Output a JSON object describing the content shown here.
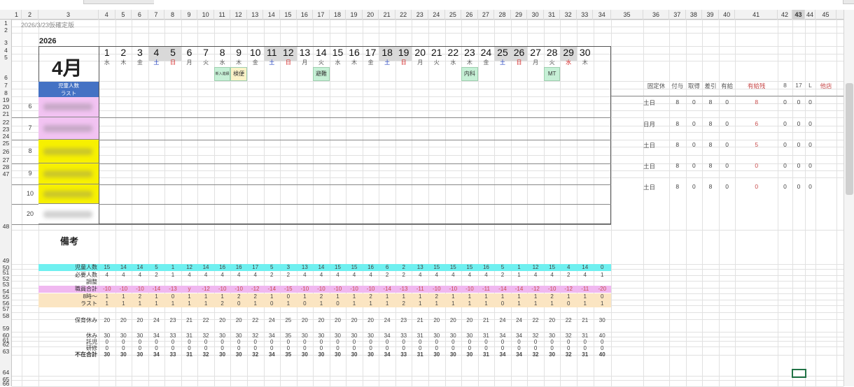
{
  "sheet": {
    "version_note": "2026/3/23仮確定版",
    "year": "2026",
    "month": "4月",
    "label_children": "児童人数",
    "label_last": "ラスト",
    "remarks_label": "備考",
    "selected_column": "43"
  },
  "column_headers": [
    "1",
    "2",
    "3",
    "4",
    "5",
    "6",
    "7",
    "8",
    "9",
    "10",
    "11",
    "12",
    "13",
    "14",
    "15",
    "16",
    "17",
    "18",
    "19",
    "20",
    "21",
    "22",
    "23",
    "24",
    "25",
    "26",
    "27",
    "28",
    "29",
    "30",
    "31",
    "32",
    "33",
    "34",
    "35",
    "36",
    "37",
    "38",
    "39",
    "40",
    "41",
    "42",
    "43",
    "44",
    "45"
  ],
  "row_headers": [
    "1",
    "2",
    "3",
    "4",
    "5",
    "6",
    "7",
    "8",
    "19",
    "20",
    "21",
    "22",
    "23",
    "24",
    "25",
    "26",
    "27",
    "28",
    "47",
    "48",
    "49",
    "50",
    "51",
    "52",
    "53",
    "54",
    "55",
    "56",
    "57",
    "58",
    "59",
    "60",
    "61",
    "62",
    "63",
    "64",
    "65",
    "66"
  ],
  "days": [
    {
      "d": "1",
      "w": "水",
      "sh": false,
      "c": "#555"
    },
    {
      "d": "2",
      "w": "木",
      "sh": false,
      "c": "#555"
    },
    {
      "d": "3",
      "w": "金",
      "sh": false,
      "c": "#555"
    },
    {
      "d": "4",
      "w": "土",
      "sh": true,
      "c": "#1f3fbf"
    },
    {
      "d": "5",
      "w": "日",
      "sh": true,
      "c": "#d42020"
    },
    {
      "d": "6",
      "w": "月",
      "sh": false,
      "c": "#555"
    },
    {
      "d": "7",
      "w": "火",
      "sh": false,
      "c": "#555"
    },
    {
      "d": "8",
      "w": "水",
      "sh": false,
      "c": "#555"
    },
    {
      "d": "9",
      "w": "木",
      "sh": false,
      "c": "#555"
    },
    {
      "d": "10",
      "w": "金",
      "sh": false,
      "c": "#555"
    },
    {
      "d": "11",
      "w": "土",
      "sh": true,
      "c": "#1f3fbf"
    },
    {
      "d": "12",
      "w": "日",
      "sh": true,
      "c": "#d42020"
    },
    {
      "d": "13",
      "w": "月",
      "sh": false,
      "c": "#555"
    },
    {
      "d": "14",
      "w": "火",
      "sh": false,
      "c": "#555"
    },
    {
      "d": "15",
      "w": "水",
      "sh": false,
      "c": "#555"
    },
    {
      "d": "16",
      "w": "木",
      "sh": false,
      "c": "#555"
    },
    {
      "d": "17",
      "w": "金",
      "sh": false,
      "c": "#555"
    },
    {
      "d": "18",
      "w": "土",
      "sh": true,
      "c": "#1f3fbf"
    },
    {
      "d": "19",
      "w": "日",
      "sh": true,
      "c": "#d42020"
    },
    {
      "d": "20",
      "w": "月",
      "sh": false,
      "c": "#555"
    },
    {
      "d": "21",
      "w": "火",
      "sh": false,
      "c": "#555"
    },
    {
      "d": "22",
      "w": "水",
      "sh": false,
      "c": "#555"
    },
    {
      "d": "23",
      "w": "木",
      "sh": false,
      "c": "#555"
    },
    {
      "d": "24",
      "w": "金",
      "sh": false,
      "c": "#555"
    },
    {
      "d": "25",
      "w": "土",
      "sh": true,
      "c": "#1f3fbf"
    },
    {
      "d": "26",
      "w": "日",
      "sh": true,
      "c": "#d42020"
    },
    {
      "d": "27",
      "w": "月",
      "sh": false,
      "c": "#555"
    },
    {
      "d": "28",
      "w": "火",
      "sh": false,
      "c": "#555"
    },
    {
      "d": "29",
      "w": "水",
      "sh": true,
      "c": "#d42020"
    },
    {
      "d": "30",
      "w": "木",
      "sh": false,
      "c": "#555"
    }
  ],
  "events": [
    {
      "day": 8,
      "text": "新入進級"
    },
    {
      "day": 9,
      "text": "検便"
    },
    {
      "day": 14,
      "text": "避難"
    },
    {
      "day": 23,
      "text": "内科"
    },
    {
      "day": 28,
      "text": "MT"
    }
  ],
  "staff_rows": [
    {
      "num": "6",
      "color": "#f2c3f2",
      "rn": [
        "19",
        "20"
      ]
    },
    {
      "num": "7",
      "color": "#f2c3f2",
      "rn": [
        "21",
        "22"
      ]
    },
    {
      "num": "8",
      "color": "#f7f000",
      "rn": [
        "23",
        "24"
      ]
    },
    {
      "num": "9",
      "color": "#f7f000",
      "rn": [
        "25",
        "26"
      ]
    },
    {
      "num": "10",
      "color": "#f7f000",
      "rn": [
        "27",
        "28"
      ]
    },
    {
      "num": "20",
      "color": "#ffffff",
      "rn": [
        "47",
        "48"
      ]
    }
  ],
  "summary_headers": [
    "固定休",
    "付与",
    "取得",
    "差引",
    "有給",
    "有給残",
    "8",
    "17",
    "L",
    "他店"
  ],
  "summary_rows": [
    [
      "土日",
      "8",
      "0",
      "8",
      "0",
      "8",
      "0",
      "0",
      "0"
    ],
    [
      "日月",
      "8",
      "0",
      "8",
      "0",
      "6",
      "0",
      "0",
      "0"
    ],
    [
      "土日",
      "8",
      "0",
      "8",
      "0",
      "5",
      "0",
      "0",
      "0"
    ],
    [
      "土日",
      "8",
      "0",
      "8",
      "0",
      "0",
      "0",
      "0",
      "0"
    ],
    [
      "土日",
      "8",
      "0",
      "8",
      "0",
      "0",
      "0",
      "0",
      "0"
    ]
  ],
  "bottom_rows": [
    {
      "label": "児童人数",
      "bg": "#6ff0f0",
      "vals": [
        "15",
        "14",
        "14",
        "5",
        "1",
        "12",
        "14",
        "16",
        "16",
        "17",
        "5",
        "3",
        "13",
        "14",
        "15",
        "15",
        "16",
        "6",
        "2",
        "13",
        "15",
        "15",
        "15",
        "16",
        "5",
        "1",
        "12",
        "15",
        "4",
        "14",
        "0"
      ]
    },
    {
      "label": "必要人数",
      "bg": "#ffffff",
      "vals": [
        "4",
        "4",
        "4",
        "2",
        "1",
        "4",
        "4",
        "4",
        "4",
        "4",
        "2",
        "2",
        "4",
        "4",
        "4",
        "4",
        "4",
        "2",
        "2",
        "4",
        "4",
        "4",
        "4",
        "4",
        "2",
        "1",
        "4",
        "4",
        "2",
        "4",
        "1"
      ]
    },
    {
      "label": "調整",
      "bg": "#ffffff",
      "vals": []
    },
    {
      "label": "職員合計",
      "bg": "#f0b8f0",
      "vals": [
        "-10",
        "-10",
        "-10",
        "-14",
        "-13",
        "y",
        "-12",
        "-10",
        "-10",
        "-12",
        "-14",
        "-15",
        "-10",
        "-10",
        "-10",
        "-10",
        "-10",
        "-14",
        "-13",
        "-11",
        "-10",
        "-10",
        "-10",
        "-11",
        "-14",
        "-14",
        "-12",
        "-10",
        "-12",
        "-11",
        "-20"
      ]
    },
    {
      "label": "8時～",
      "bg": "#fbe5c2",
      "vals": [
        "1",
        "1",
        "2",
        "1",
        "0",
        "1",
        "1",
        "1",
        "2",
        "2",
        "1",
        "0",
        "1",
        "2",
        "1",
        "1",
        "2",
        "1",
        "1",
        "1",
        "2",
        "1",
        "1",
        "1",
        "1",
        "1",
        "1",
        "2",
        "1",
        "1",
        "0"
      ]
    },
    {
      "label": "ラスト",
      "bg": "#fbe5c2",
      "vals": [
        "1",
        "1",
        "1",
        "1",
        "1",
        "1",
        "1",
        "2",
        "0",
        "1",
        "0",
        "1",
        "0",
        "1",
        "0",
        "1",
        "1",
        "1",
        "2",
        "1",
        "1",
        "1",
        "1",
        "1",
        "0",
        "1",
        "1",
        "1",
        "0",
        "1",
        "1"
      ]
    },
    {
      "label": "",
      "bg": "#ffffff",
      "vals": []
    },
    {
      "label": "保育休み",
      "bg": "#ffffff",
      "vals": [
        "20",
        "20",
        "20",
        "24",
        "23",
        "21",
        "22",
        "20",
        "20",
        "22",
        "24",
        "25",
        "20",
        "20",
        "20",
        "20",
        "20",
        "24",
        "23",
        "21",
        "20",
        "20",
        "20",
        "21",
        "24",
        "24",
        "22",
        "20",
        "22",
        "21",
        "30"
      ]
    },
    {
      "label": "",
      "bg": "#ffffff",
      "vals": []
    },
    {
      "label": "休み",
      "bg": "#ffffff",
      "vals": [
        "30",
        "30",
        "30",
        "34",
        "33",
        "31",
        "32",
        "30",
        "30",
        "32",
        "34",
        "35",
        "30",
        "30",
        "30",
        "30",
        "30",
        "34",
        "33",
        "31",
        "30",
        "30",
        "30",
        "31",
        "34",
        "34",
        "32",
        "30",
        "32",
        "31",
        "40"
      ]
    },
    {
      "label": "託児",
      "bg": "#ffffff",
      "vals": [
        "0",
        "0",
        "0",
        "0",
        "0",
        "0",
        "0",
        "0",
        "0",
        "0",
        "0",
        "0",
        "0",
        "0",
        "0",
        "0",
        "0",
        "0",
        "0",
        "0",
        "0",
        "0",
        "0",
        "0",
        "0",
        "0",
        "0",
        "0",
        "0",
        "0",
        "0"
      ]
    },
    {
      "label": "研修",
      "bg": "#ffffff",
      "vals": [
        "0",
        "0",
        "0",
        "0",
        "0",
        "0",
        "0",
        "0",
        "0",
        "0",
        "0",
        "0",
        "0",
        "0",
        "0",
        "0",
        "0",
        "0",
        "0",
        "0",
        "0",
        "0",
        "0",
        "0",
        "0",
        "0",
        "0",
        "0",
        "0",
        "0",
        "0"
      ]
    },
    {
      "label": "不在合計",
      "bg": "#ffffff",
      "bold": true,
      "vals": [
        "30",
        "30",
        "30",
        "34",
        "33",
        "31",
        "32",
        "30",
        "30",
        "32",
        "34",
        "35",
        "30",
        "30",
        "30",
        "30",
        "30",
        "34",
        "33",
        "31",
        "30",
        "30",
        "30",
        "31",
        "34",
        "34",
        "32",
        "30",
        "32",
        "31",
        "40"
      ]
    }
  ],
  "colors": {
    "accent_blue": "#4472c4",
    "sunday_red": "#d42020",
    "saturday_blue": "#1f3fbf",
    "event_green": "#c6f0d6",
    "event_yellow": "#fbf3c8",
    "select_green": "#217346"
  }
}
